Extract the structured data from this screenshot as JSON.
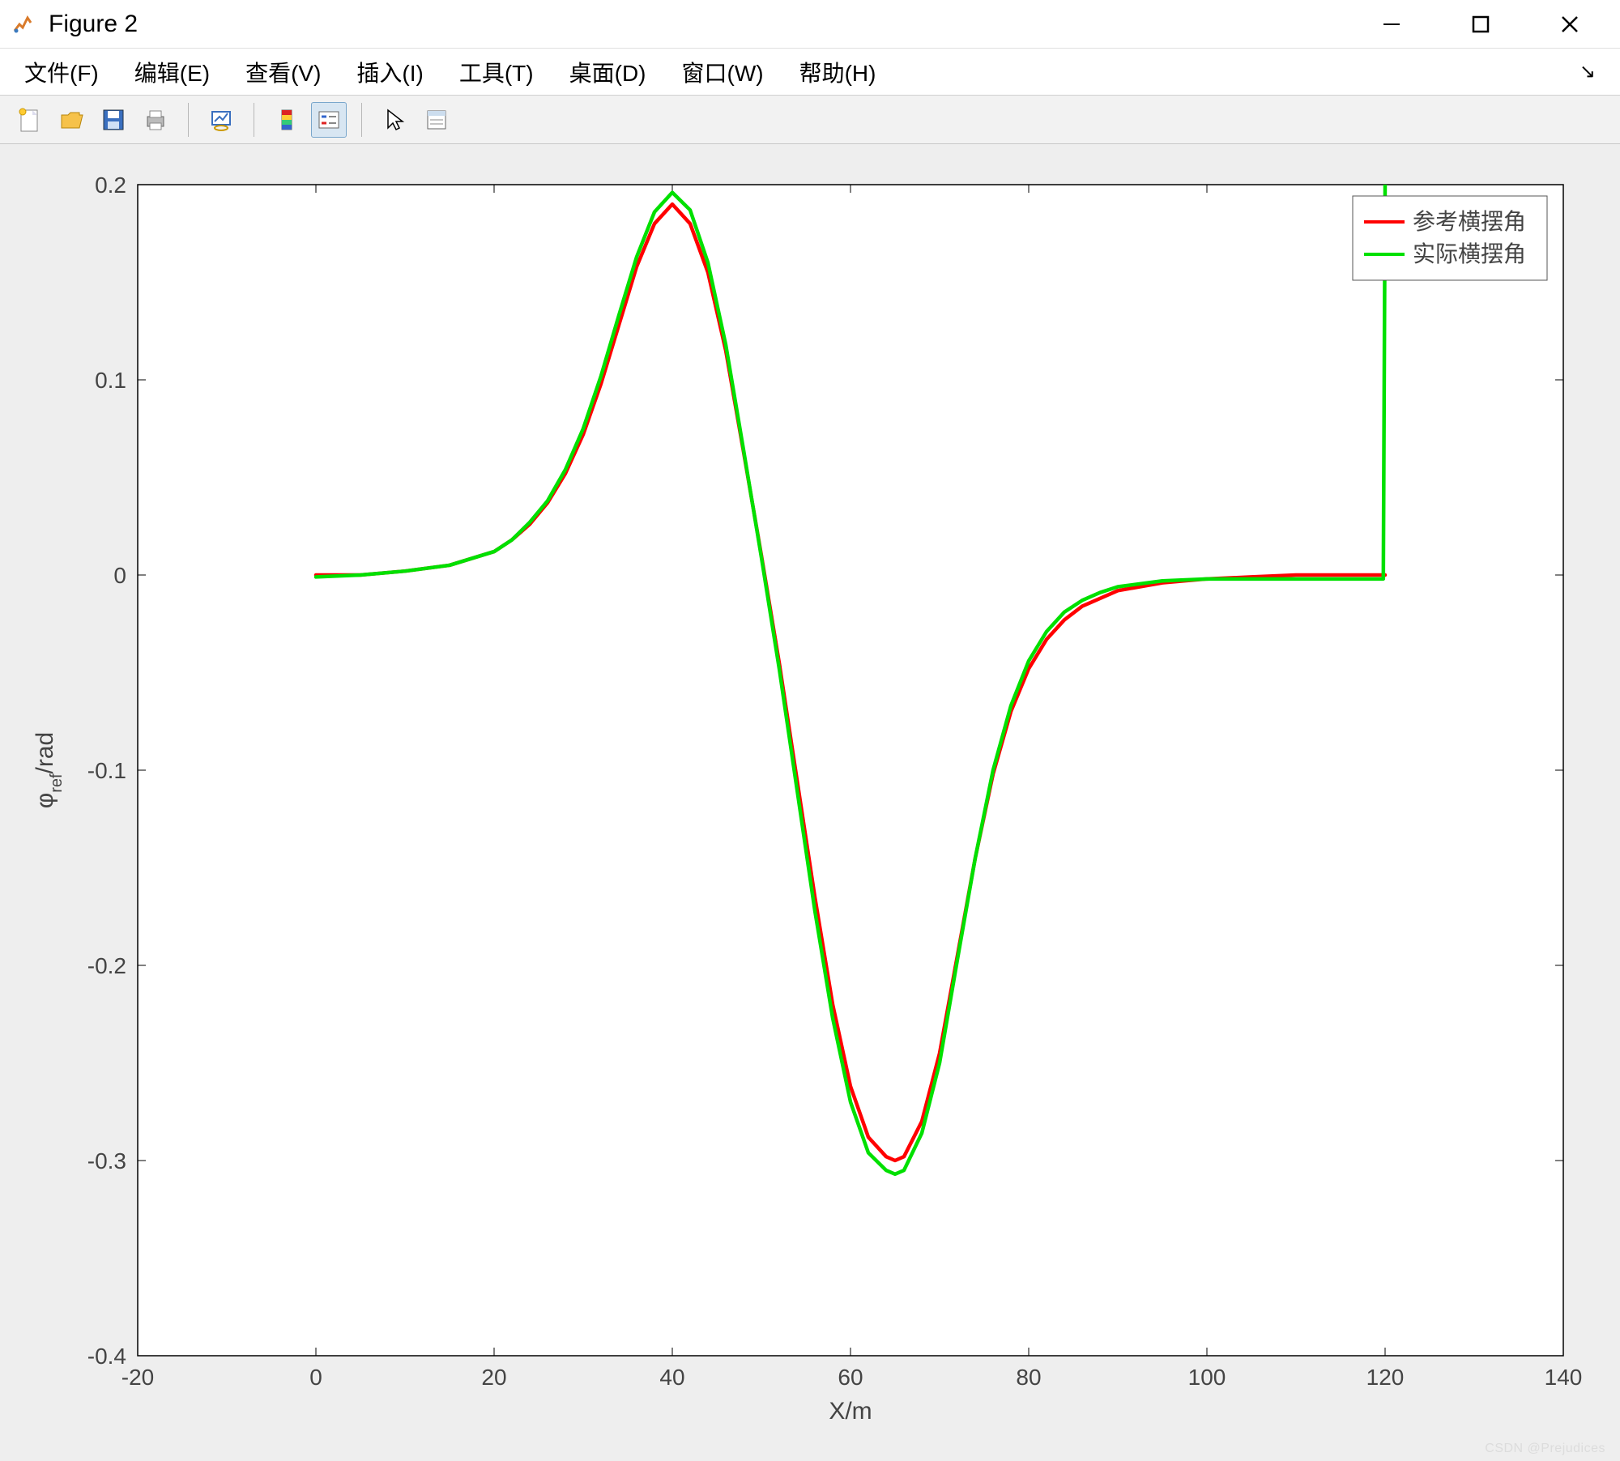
{
  "window": {
    "title": "Figure 2"
  },
  "menu": {
    "file": "文件(F)",
    "edit": "编辑(E)",
    "view": "查看(V)",
    "insert": "插入(I)",
    "tools": "工具(T)",
    "desktop": "桌面(D)",
    "window": "窗口(W)",
    "help": "帮助(H)"
  },
  "toolbar": {
    "new": "new-figure",
    "open": "open",
    "save": "save",
    "print": "print",
    "link": "link-data",
    "colorbar": "insert-colorbar",
    "legend": "insert-legend",
    "cursor": "edit-plot",
    "props": "property-inspector"
  },
  "watermark": "CSDN @Prejudices",
  "chart_data": {
    "type": "line",
    "xlabel": "X/m",
    "ylabel": "φ_ref/rad",
    "ylabel_plain": "phi_ref/rad",
    "xlim": [
      -20,
      140
    ],
    "ylim": [
      -0.4,
      0.2
    ],
    "xticks": [
      -20,
      0,
      20,
      40,
      60,
      80,
      100,
      120,
      140
    ],
    "yticks": [
      -0.4,
      -0.3,
      -0.2,
      -0.1,
      0,
      0.1,
      0.2
    ],
    "legend_position": "northeast",
    "series": [
      {
        "name": "参考横摆角",
        "color": "#ff0000",
        "x": [
          0,
          5,
          10,
          15,
          20,
          22,
          24,
          26,
          28,
          30,
          32,
          34,
          36,
          38,
          40,
          42,
          44,
          46,
          48,
          50,
          52,
          54,
          56,
          58,
          60,
          62,
          64,
          65,
          66,
          68,
          70,
          72,
          74,
          76,
          78,
          80,
          82,
          84,
          86,
          88,
          90,
          95,
          100,
          105,
          110,
          115,
          120
        ],
        "y": [
          0.0,
          0.0,
          0.002,
          0.005,
          0.012,
          0.018,
          0.026,
          0.037,
          0.052,
          0.072,
          0.098,
          0.128,
          0.158,
          0.18,
          0.19,
          0.18,
          0.155,
          0.115,
          0.063,
          0.01,
          -0.045,
          -0.105,
          -0.165,
          -0.22,
          -0.262,
          -0.288,
          -0.298,
          -0.3,
          -0.298,
          -0.28,
          -0.245,
          -0.195,
          -0.145,
          -0.102,
          -0.07,
          -0.048,
          -0.033,
          -0.023,
          -0.016,
          -0.012,
          -0.008,
          -0.004,
          -0.002,
          -0.001,
          0.0,
          0.0,
          0.0
        ]
      },
      {
        "name": "实际横摆角",
        "color": "#00e000",
        "x": [
          0,
          5,
          10,
          15,
          20,
          22,
          24,
          26,
          28,
          30,
          32,
          34,
          36,
          38,
          40,
          42,
          44,
          46,
          48,
          50,
          52,
          54,
          56,
          58,
          60,
          62,
          64,
          65,
          66,
          68,
          70,
          72,
          74,
          76,
          78,
          80,
          82,
          84,
          86,
          88,
          90,
          95,
          100,
          105,
          110,
          115,
          119.8,
          120,
          120
        ],
        "y": [
          -0.001,
          0.0,
          0.002,
          0.005,
          0.012,
          0.018,
          0.027,
          0.038,
          0.054,
          0.075,
          0.102,
          0.133,
          0.163,
          0.186,
          0.196,
          0.187,
          0.16,
          0.118,
          0.064,
          0.009,
          -0.048,
          -0.11,
          -0.172,
          -0.227,
          -0.27,
          -0.296,
          -0.305,
          -0.307,
          -0.305,
          -0.286,
          -0.25,
          -0.197,
          -0.145,
          -0.1,
          -0.067,
          -0.044,
          -0.029,
          -0.019,
          -0.013,
          -0.009,
          -0.006,
          -0.003,
          -0.002,
          -0.002,
          -0.002,
          -0.002,
          -0.002,
          0.2,
          0.2
        ]
      }
    ]
  }
}
